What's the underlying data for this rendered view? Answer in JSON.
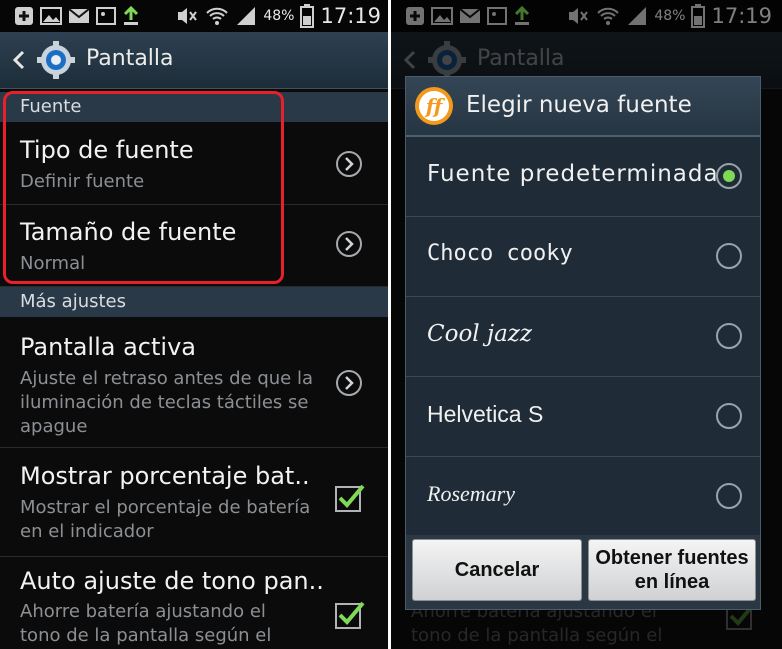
{
  "status_bar": {
    "battery_percent": "48%",
    "time": "17:19"
  },
  "left": {
    "action_bar": {
      "title": "Pantalla"
    },
    "sections": {
      "fuente": "Fuente",
      "mas_ajustes": "Más ajustes"
    },
    "items": [
      {
        "title": "Tipo de fuente",
        "subtitle": "Definir fuente",
        "control": "chevron"
      },
      {
        "title": "Tamaño de fuente",
        "subtitle": "Normal",
        "control": "chevron"
      },
      {
        "title": "Pantalla activa",
        "subtitle_lines": [
          "Ajuste el retraso antes de que la",
          "iluminación de teclas táctiles se",
          "apague"
        ],
        "control": "chevron"
      },
      {
        "title": "Mostrar porcentaje bat..",
        "subtitle_lines": [
          "Mostrar el porcentaje de batería",
          "en el indicador"
        ],
        "control": "checkbox",
        "checked": true
      },
      {
        "title": "Auto ajuste de tono pan..",
        "subtitle_lines": [
          "Ahorre batería ajustando el",
          "tono de la pantalla según el"
        ],
        "control": "checkbox",
        "checked": true
      }
    ]
  },
  "right": {
    "background": {
      "title": "Pantalla",
      "subtitle_lines": [
        "Ahorre batería ajustando el",
        "tono de la pantalla según el"
      ]
    },
    "dialog": {
      "title": "Elegir nueva fuente",
      "logo_text": "ff",
      "options": [
        {
          "label": "Fuente predeterminada",
          "selected": true
        },
        {
          "label": "Choco cooky",
          "selected": false
        },
        {
          "label": "Cool jazz",
          "selected": false
        },
        {
          "label": "Helvetica S",
          "selected": false
        },
        {
          "label": "Rosemary",
          "selected": false
        }
      ],
      "cancel_label": "Cancelar",
      "online_label_lines": [
        "Obtener fuentes",
        "en línea"
      ]
    }
  },
  "colors": {
    "accent_green": "#7ed957",
    "highlight_red": "#e8202a",
    "logo_orange": "#f39a1e"
  }
}
